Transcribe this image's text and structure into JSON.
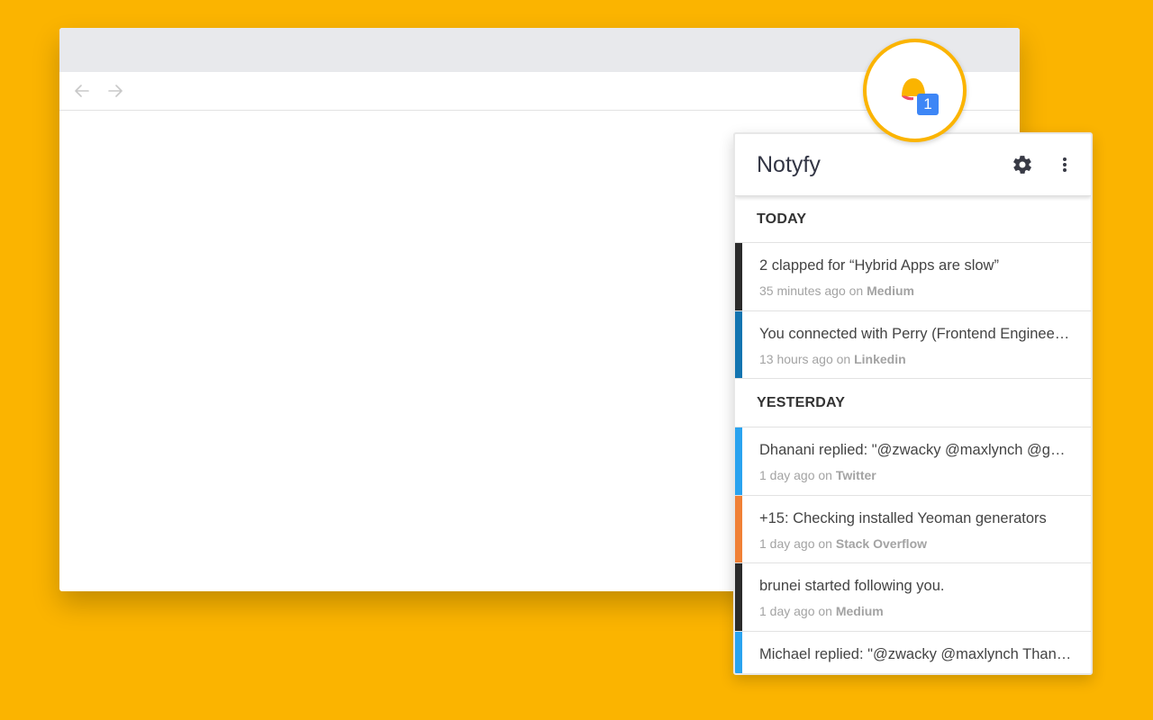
{
  "popup": {
    "title": "Notyfy",
    "badge_count": "1",
    "sections": [
      {
        "label": "TODAY",
        "items": [
          {
            "text": "2 clapped for “Hybrid Apps are slow”",
            "time": "35 minutes ago",
            "on": "on",
            "source": "Medium",
            "color": "#2B2B2B"
          },
          {
            "text": "You connected with Perry (Frontend Engineer at...",
            "time": "13 hours ago",
            "on": "on",
            "source": "Linkedin",
            "color": "#1274B0"
          }
        ]
      },
      {
        "label": "YESTERDAY",
        "items": [
          {
            "text": "Dhanani replied: \"@zwacky @maxlynch @getnotyfy...",
            "time": "1 day ago",
            "on": "on",
            "source": "Twitter",
            "color": "#2AA3EF"
          },
          {
            "text": "+15: Checking installed Yeoman generators",
            "time": "1 day ago",
            "on": "on",
            "source": "Stack Overflow",
            "color": "#F08035"
          },
          {
            "text": "brunei started following you.",
            "time": "1 day ago",
            "on": "on",
            "source": "Medium",
            "color": "#2B2B2B"
          },
          {
            "text": "Michael replied: \"@zwacky @maxlynch Thanks for...",
            "time": "",
            "on": "",
            "source": "",
            "color": "#2AA3EF"
          }
        ]
      }
    ]
  },
  "icons": {
    "back": "arrow-left-icon",
    "forward": "arrow-right-icon",
    "extension": "bell-icon",
    "settings": "gear-icon",
    "more": "more-vert-icon"
  },
  "colors": {
    "background": "#FBB400",
    "badge": "#3D86F6"
  }
}
